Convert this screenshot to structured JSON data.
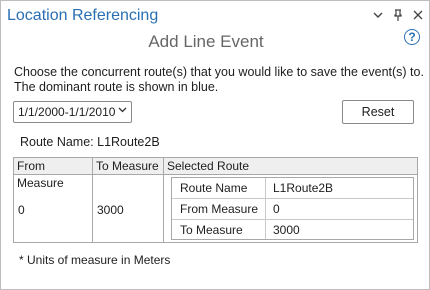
{
  "window": {
    "title": "Location Referencing",
    "controls": [
      "chevron-down-icon",
      "pin-icon",
      "close-icon"
    ]
  },
  "heading": "Add Line Event",
  "instructions": {
    "line1": "Choose the concurrent route(s) that you would like to save the event(s) to.",
    "line2": "The dominant route is shown in blue."
  },
  "date_range": {
    "selected": "1/1/2000-1/1/2010"
  },
  "reset_label": "Reset",
  "route_name_text": "Route Name: L1Route2B",
  "table": {
    "headers": {
      "from": "From Measure",
      "to": "To Measure",
      "selected": "Selected Route"
    },
    "row": {
      "from": "0",
      "to": "3000"
    },
    "selected_route": [
      {
        "label": "Route Name",
        "value": "L1Route2B"
      },
      {
        "label": "From Measure",
        "value": "0"
      },
      {
        "label": "To Measure",
        "value": "3000"
      }
    ]
  },
  "note": "* Units of measure in Meters",
  "colors": {
    "accent": "#2a6fb3",
    "heading": "#666666"
  }
}
